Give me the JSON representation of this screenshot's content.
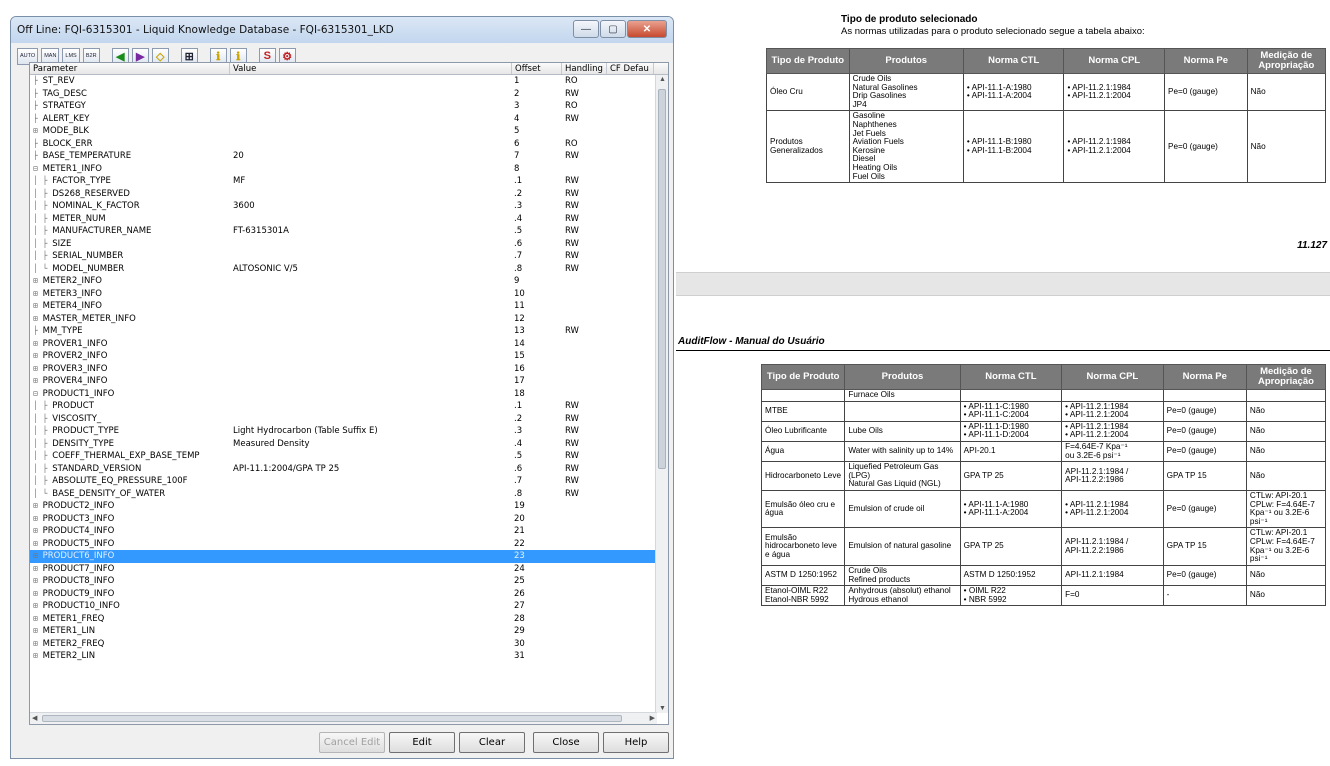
{
  "window": {
    "title": "Off Line: FQI-6315301 - Liquid Knowledge Database - FQI-6315301_LKD",
    "minimize_label": "—",
    "maximize_label": "▢",
    "close_label": "✕"
  },
  "toolbar": {
    "buttons": [
      "AUTO",
      "MAN",
      "LMS",
      "B2R"
    ],
    "nav_left": "◀",
    "nav_right": "▶",
    "diamond": "◇",
    "icon_a": "⊞",
    "icon_b": "ℹ",
    "icon_c": "ℹ",
    "icon_d": "S",
    "icon_e": "⚙"
  },
  "grid": {
    "columns": [
      "Parameter",
      "Value",
      "Offset",
      "Handling",
      "CF Defau"
    ],
    "selected_index": 38,
    "rows": [
      {
        "prefix": "├",
        "name": "ST_REV",
        "value": "",
        "offset": "1",
        "handling": "RO"
      },
      {
        "prefix": "├",
        "name": "TAG_DESC",
        "value": "",
        "offset": "2",
        "handling": "RW"
      },
      {
        "prefix": "├",
        "name": "STRATEGY",
        "value": "",
        "offset": "3",
        "handling": "RO"
      },
      {
        "prefix": "├",
        "name": "ALERT_KEY",
        "value": "",
        "offset": "4",
        "handling": "RW"
      },
      {
        "prefix": "⊞",
        "name": "MODE_BLK",
        "value": "",
        "offset": "5",
        "handling": ""
      },
      {
        "prefix": "├",
        "name": "BLOCK_ERR",
        "value": "",
        "offset": "6",
        "handling": "RO"
      },
      {
        "prefix": "├",
        "name": "BASE_TEMPERATURE",
        "value": "20",
        "offset": "7",
        "handling": "RW"
      },
      {
        "prefix": "⊟",
        "name": "METER1_INFO",
        "value": "",
        "offset": "8",
        "handling": ""
      },
      {
        "prefix": "│ ├",
        "name": "FACTOR_TYPE",
        "value": "MF",
        "offset": ".1",
        "handling": "RW"
      },
      {
        "prefix": "│ ├",
        "name": "DS268_RESERVED",
        "value": "",
        "offset": ".2",
        "handling": "RW"
      },
      {
        "prefix": "│ ├",
        "name": "NOMINAL_K_FACTOR",
        "value": "3600",
        "offset": ".3",
        "handling": "RW"
      },
      {
        "prefix": "│ ├",
        "name": "METER_NUM",
        "value": "",
        "offset": ".4",
        "handling": "RW"
      },
      {
        "prefix": "│ ├",
        "name": "MANUFACTURER_NAME",
        "value": "FT-6315301A",
        "offset": ".5",
        "handling": "RW"
      },
      {
        "prefix": "│ ├",
        "name": "SIZE",
        "value": "",
        "offset": ".6",
        "handling": "RW"
      },
      {
        "prefix": "│ ├",
        "name": "SERIAL_NUMBER",
        "value": "",
        "offset": ".7",
        "handling": "RW"
      },
      {
        "prefix": "│ └",
        "name": "MODEL_NUMBER",
        "value": "ALTOSONIC V/5",
        "offset": ".8",
        "handling": "RW"
      },
      {
        "prefix": "⊞",
        "name": "METER2_INFO",
        "value": "",
        "offset": "9",
        "handling": ""
      },
      {
        "prefix": "⊞",
        "name": "METER3_INFO",
        "value": "",
        "offset": "10",
        "handling": ""
      },
      {
        "prefix": "⊞",
        "name": "METER4_INFO",
        "value": "",
        "offset": "11",
        "handling": ""
      },
      {
        "prefix": "⊞",
        "name": "MASTER_METER_INFO",
        "value": "",
        "offset": "12",
        "handling": ""
      },
      {
        "prefix": "├",
        "name": "MM_TYPE",
        "value": "",
        "offset": "13",
        "handling": "RW"
      },
      {
        "prefix": "⊞",
        "name": "PROVER1_INFO",
        "value": "",
        "offset": "14",
        "handling": ""
      },
      {
        "prefix": "⊞",
        "name": "PROVER2_INFO",
        "value": "",
        "offset": "15",
        "handling": ""
      },
      {
        "prefix": "⊞",
        "name": "PROVER3_INFO",
        "value": "",
        "offset": "16",
        "handling": ""
      },
      {
        "prefix": "⊞",
        "name": "PROVER4_INFO",
        "value": "",
        "offset": "17",
        "handling": ""
      },
      {
        "prefix": "⊟",
        "name": "PRODUCT1_INFO",
        "value": "",
        "offset": "18",
        "handling": ""
      },
      {
        "prefix": "│ ├",
        "name": "PRODUCT",
        "value": "",
        "offset": ".1",
        "handling": "RW"
      },
      {
        "prefix": "│ ├",
        "name": "VISCOSITY_",
        "value": "",
        "offset": ".2",
        "handling": "RW"
      },
      {
        "prefix": "│ ├",
        "name": "PRODUCT_TYPE",
        "value": "Light Hydrocarbon (Table Suffix E)",
        "offset": ".3",
        "handling": "RW"
      },
      {
        "prefix": "│ ├",
        "name": "DENSITY_TYPE",
        "value": "Measured Density",
        "offset": ".4",
        "handling": "RW"
      },
      {
        "prefix": "│ ├",
        "name": "COEFF_THERMAL_EXP_BASE_TEMP",
        "value": "",
        "offset": ".5",
        "handling": "RW"
      },
      {
        "prefix": "│ ├",
        "name": "STANDARD_VERSION",
        "value": "API-11.1:2004/GPA TP 25",
        "offset": ".6",
        "handling": "RW"
      },
      {
        "prefix": "│ ├",
        "name": "ABSOLUTE_EQ_PRESSURE_100F",
        "value": "",
        "offset": ".7",
        "handling": "RW"
      },
      {
        "prefix": "│ └",
        "name": "BASE_DENSITY_OF_WATER",
        "value": "",
        "offset": ".8",
        "handling": "RW"
      },
      {
        "prefix": "⊞",
        "name": "PRODUCT2_INFO",
        "value": "",
        "offset": "19",
        "handling": ""
      },
      {
        "prefix": "⊞",
        "name": "PRODUCT3_INFO",
        "value": "",
        "offset": "20",
        "handling": ""
      },
      {
        "prefix": "⊞",
        "name": "PRODUCT4_INFO",
        "value": "",
        "offset": "21",
        "handling": ""
      },
      {
        "prefix": "⊞",
        "name": "PRODUCT5_INFO",
        "value": "",
        "offset": "22",
        "handling": ""
      },
      {
        "prefix": "⊞",
        "name": "PRODUCT6_INFO",
        "value": "",
        "offset": "23",
        "handling": ""
      },
      {
        "prefix": "⊞",
        "name": "PRODUCT7_INFO",
        "value": "",
        "offset": "24",
        "handling": ""
      },
      {
        "prefix": "⊞",
        "name": "PRODUCT8_INFO",
        "value": "",
        "offset": "25",
        "handling": ""
      },
      {
        "prefix": "⊞",
        "name": "PRODUCT9_INFO",
        "value": "",
        "offset": "26",
        "handling": ""
      },
      {
        "prefix": "⊞",
        "name": "PRODUCT10_INFO",
        "value": "",
        "offset": "27",
        "handling": ""
      },
      {
        "prefix": "⊞",
        "name": "METER1_FREQ",
        "value": "",
        "offset": "28",
        "handling": ""
      },
      {
        "prefix": "⊞",
        "name": "METER1_LIN",
        "value": "",
        "offset": "29",
        "handling": ""
      },
      {
        "prefix": "⊞",
        "name": "METER2_FREQ",
        "value": "",
        "offset": "30",
        "handling": ""
      },
      {
        "prefix": "⊞",
        "name": "METER2_LIN",
        "value": "",
        "offset": "31",
        "handling": ""
      }
    ]
  },
  "footer": {
    "cancel_edit": "Cancel Edit",
    "edit": "Edit",
    "clear": "Clear",
    "close": "Close",
    "help": "Help"
  },
  "doc": {
    "section_title": "Tipo de produto selecionado",
    "section_subtitle": "As normas utilizadas para o produto selecionado segue a tabela abaixo:",
    "headers": [
      "Tipo de Produto",
      "Produtos",
      "Norma CTL",
      "Norma CPL",
      "Norma Pe",
      "Medição de Apropriação"
    ],
    "page_number": "11.127",
    "running_header": "AuditFlow - Manual do Usuário",
    "table1": [
      {
        "tipo": "Óleo Cru",
        "produtos": [
          "Crude Oils",
          "Natural Gasolines",
          "Drip Gasolines",
          "JP4"
        ],
        "ctl": [
          "API-11.1-A:1980",
          "API-11.1-A:2004"
        ],
        "cpl": [
          "API-11.2.1:1984",
          "API-11.2.1:2004"
        ],
        "pe": "Pe=0 (gauge)",
        "med": "Não"
      },
      {
        "tipo": "Produtos Generalizados",
        "produtos": [
          "Gasoline",
          "Naphthenes",
          "Jet Fuels",
          "Aviation Fuels",
          "Kerosine",
          "Diesel",
          "Heating Oils",
          "Fuel Oils"
        ],
        "ctl": [
          "API-11.1-B:1980",
          "API-11.1-B:2004"
        ],
        "cpl": [
          "API-11.2.1:1984",
          "API-11.2.1:2004"
        ],
        "pe": "Pe=0 (gauge)",
        "med": "Não"
      }
    ],
    "table2_cont": "Furnace Oils",
    "table2": [
      {
        "tipo": "MTBE",
        "produtos": [],
        "ctl": [
          "API-11.1-C:1980",
          "API-11.1-C:2004"
        ],
        "cpl": [
          "API-11.2.1:1984",
          "API-11.2.1:2004"
        ],
        "pe": "Pe=0 (gauge)",
        "med": "Não",
        "ctl_b": true,
        "cpl_b": true
      },
      {
        "tipo": "Óleo Lubrificante",
        "produtos": [
          "Lube Oils"
        ],
        "ctl": [
          "API-11.1-D:1980",
          "API-11.1-D:2004"
        ],
        "cpl": [
          "API-11.2.1:1984",
          "API-11.2.1:2004"
        ],
        "pe": "Pe=0 (gauge)",
        "med": "Não",
        "ctl_b": true,
        "cpl_b": true
      },
      {
        "tipo": "Água",
        "produtos": [
          "Water with salinity up to 14%"
        ],
        "ctl": [
          "API-20.1"
        ],
        "cpl": [
          "F=4.64E-7 Kpa⁻¹",
          "ou 3.2E-6 psi⁻¹"
        ],
        "pe": "Pe=0 (gauge)",
        "med": "Não"
      },
      {
        "tipo": "Hidrocarboneto Leve",
        "produtos": [
          "Liquefied Petroleum Gas (LPG)",
          "Natural Gas Liquid (NGL)"
        ],
        "ctl": [
          "GPA TP 25"
        ],
        "cpl": [
          "API-11.2.1:1984 /",
          "API-11.2.2:1986"
        ],
        "pe": "GPA TP 15",
        "med": "Não"
      },
      {
        "tipo": "Emulsão óleo cru e água",
        "produtos": [
          "Emulsion of crude oil"
        ],
        "ctl": [
          "API-11.1-A:1980",
          "API-11.1-A:2004"
        ],
        "cpl": [
          "API-11.2.1:1984",
          "API-11.2.1:2004"
        ],
        "pe": "Pe=0 (gauge)",
        "med": "CTLw: API-20.1 CPLw: F=4.64E-7 Kpa⁻¹ ou 3.2E-6 psi⁻¹",
        "ctl_b": true,
        "cpl_b": true
      },
      {
        "tipo": "Emulsão hidrocarboneto leve e água",
        "produtos": [
          "Emulsion of natural gasoline"
        ],
        "ctl": [
          "GPA TP 25"
        ],
        "cpl": [
          "API-11.2.1:1984 /",
          "API-11.2.2:1986"
        ],
        "pe": "GPA TP 15",
        "med": "CTLw: API-20.1 CPLw: F=4.64E-7 Kpa⁻¹ ou 3.2E-6 psi⁻¹"
      },
      {
        "tipo": "ASTM D 1250:1952",
        "produtos": [
          "Crude Oils",
          "Refined products"
        ],
        "ctl": [
          "ASTM D 1250:1952"
        ],
        "cpl": [
          "API-11.2.1:1984"
        ],
        "pe": "Pe=0 (gauge)",
        "med": "Não"
      },
      {
        "tipo": "Etanol-OIML R22 Etanol-NBR 5992",
        "produtos": [
          "Anhydrous (absolut) ethanol",
          "Hydrous ethanol"
        ],
        "ctl": [
          "OIML R22",
          "NBR 5992"
        ],
        "cpl": [
          "F=0"
        ],
        "pe": "-",
        "med": "Não",
        "ctl_b": true
      }
    ]
  }
}
